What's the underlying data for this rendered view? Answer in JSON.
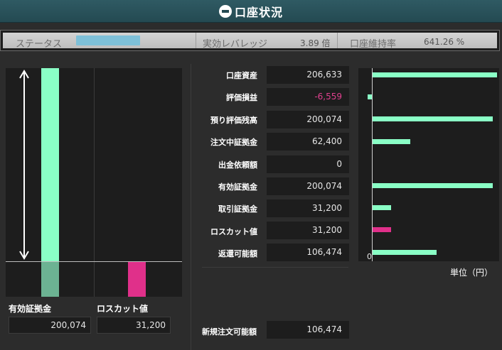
{
  "window": {
    "title": "口座状況"
  },
  "status": {
    "status_label": "ステータス",
    "status_level": null,
    "leverage_label": "実効レバレッジ",
    "leverage_value": "3.89 倍",
    "maintenance_label": "口座維持率",
    "maintenance_value": "641.26 %"
  },
  "left_chart": {
    "effective_margin_label": "有効証拠金",
    "effective_margin_value": "200,074",
    "losscut_label": "ロスカット値",
    "losscut_value": "31,200",
    "colors": {
      "effective": "#8affc6",
      "losscut": "#e0308a"
    }
  },
  "rows": [
    {
      "label": "口座資産",
      "value": "206,633"
    },
    {
      "label": "評価損益",
      "value": "-6,559"
    },
    {
      "label": "預り評価残高",
      "value": "200,074"
    },
    {
      "label": "注文中証拠金",
      "value": "62,400"
    },
    {
      "label": "出金依頼額",
      "value": "0"
    },
    {
      "label": "有効証拠金",
      "value": "200,074"
    },
    {
      "label": "取引証拠金",
      "value": "31,200"
    },
    {
      "label": "ロスカット値",
      "value": "31,200"
    },
    {
      "label": "返還可能額",
      "value": "106,474"
    }
  ],
  "new_order": {
    "label": "新規注文可能額",
    "value": "106,474"
  },
  "chart_data": {
    "type": "bar",
    "orientation": "horizontal",
    "categories": [
      "口座資産",
      "評価損益",
      "預り評価残高",
      "注文中証拠金",
      "出金依頼額",
      "有効証拠金",
      "取引証拠金",
      "ロスカット値",
      "返還可能額"
    ],
    "values": [
      206633,
      -6559,
      200074,
      62400,
      0,
      200074,
      31200,
      31200,
      106474
    ],
    "colors": [
      "#8affc6",
      "#8affc6",
      "#8affc6",
      "#8affc6",
      "#8affc6",
      "#8affc6",
      "#8affc6",
      "#e0308a",
      "#8affc6"
    ],
    "zero_label": "0",
    "unit": "単位（円）",
    "xlim": [
      -6559,
      206633
    ]
  }
}
